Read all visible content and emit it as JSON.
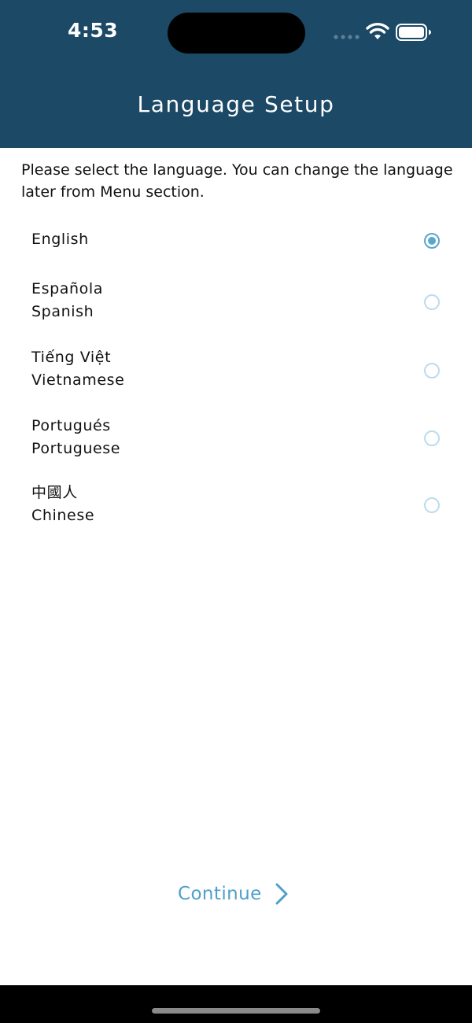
{
  "status_bar": {
    "time": "4:53"
  },
  "header": {
    "title": "Language Setup",
    "background_color": "#1b4966"
  },
  "intro_text": "Please select the language. You can change the language later from Menu section.",
  "languages": [
    {
      "native": "English",
      "english": "",
      "selected": true
    },
    {
      "native": "Española",
      "english": "Spanish",
      "selected": false
    },
    {
      "native": "Tiếng Việt",
      "english": "Vietnamese",
      "selected": false
    },
    {
      "native": "Portugués",
      "english": "Portuguese",
      "selected": false
    },
    {
      "native": "中國人",
      "english": "Chinese",
      "selected": false
    }
  ],
  "continue_button": {
    "label": "Continue",
    "icon": "chevron-right-icon",
    "color": "#4f9fca"
  },
  "accent_color": "#5aa7cc"
}
